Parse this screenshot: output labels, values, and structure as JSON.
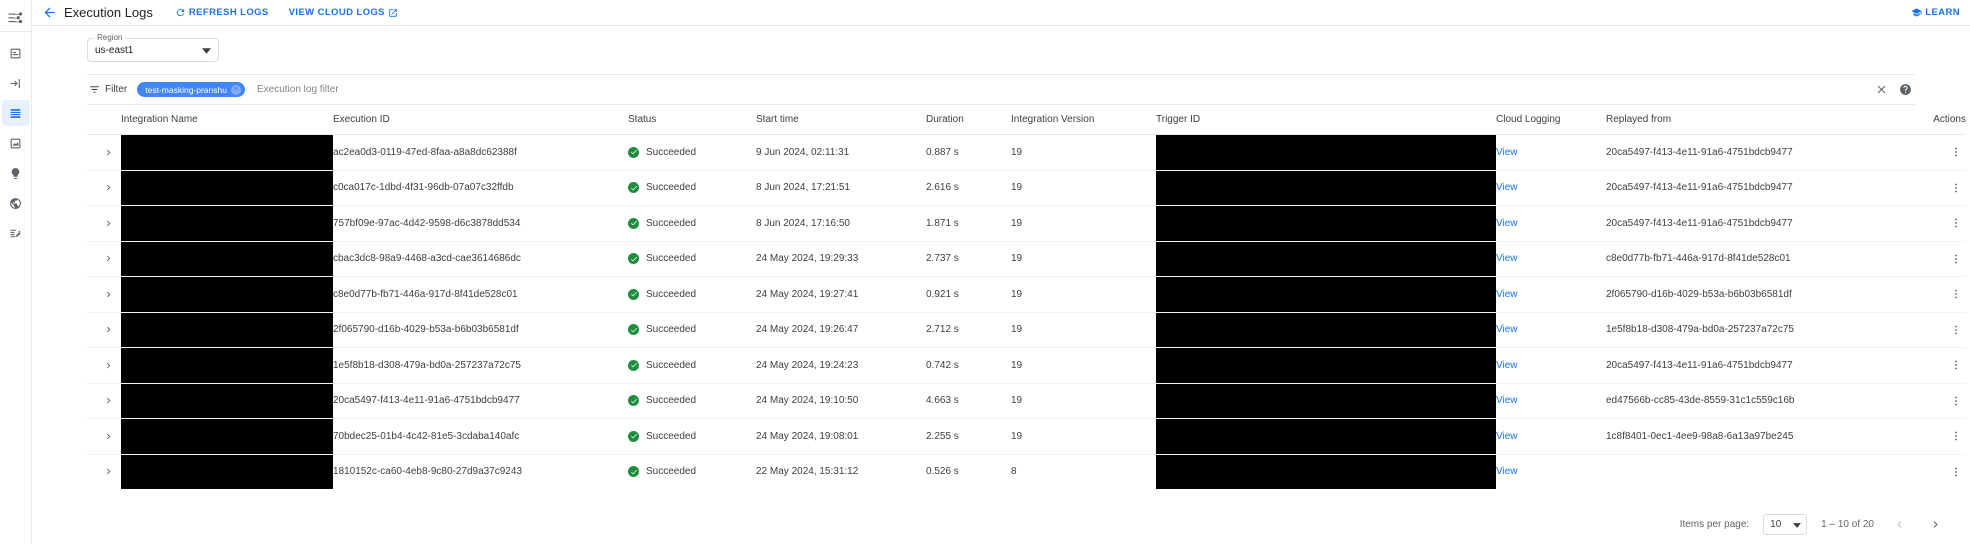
{
  "rail": {
    "logo_icon": "integrations-logo-icon",
    "items": [
      {
        "icon": "overview-icon",
        "active": false
      },
      {
        "icon": "connections-icon",
        "active": false
      },
      {
        "icon": "integrations-list-icon",
        "active": true
      },
      {
        "icon": "analytics-icon",
        "active": false
      },
      {
        "icon": "insights-icon",
        "active": false
      },
      {
        "icon": "globe-icon",
        "active": false
      },
      {
        "icon": "test-cases-icon",
        "active": false
      }
    ]
  },
  "topbar": {
    "back_icon": "back-arrow-icon",
    "title": "Execution Logs",
    "refresh_label": "REFRESH LOGS",
    "refresh_icon": "refresh-icon",
    "cloud_logs_label": "VIEW CLOUD LOGS",
    "cloud_logs_icon": "open-in-new-icon",
    "learn_label": "LEARN",
    "learn_icon": "school-icon"
  },
  "region": {
    "label": "Region",
    "value": "us-east1",
    "caret_icon": "chevron-down-icon"
  },
  "filter": {
    "icon": "filter-icon",
    "label": "Filter",
    "chip_label": "test-masking-pranshu",
    "chip_remove_icon": "chip-close-icon",
    "placeholder": "Execution log filter",
    "input_value": "",
    "clear_icon": "close-icon",
    "help_icon": "help-icon"
  },
  "table": {
    "columns": [
      "",
      "Integration Name",
      "Execution ID",
      "Status",
      "Start time",
      "Duration",
      "Integration Version",
      "Trigger ID",
      "Cloud Logging",
      "Replayed from",
      "Actions"
    ],
    "expand_icon": "chevron-right-icon",
    "status_icon": "check-circle-icon",
    "cloud_link_label": "View",
    "actions_icon": "more-vert-icon",
    "rows": [
      {
        "name_redacted": true,
        "execution_id": "ac2ea0d3-0119-47ed-8faa-a8a8dc62388f",
        "status": "Succeeded",
        "start_time": "9 Jun 2024, 02:11:31",
        "duration": "0.887 s",
        "version": "19",
        "trigger_redacted": true,
        "cloud": "View",
        "replayed_from": "20ca5497-f413-4e11-91a6-4751bdcb9477"
      },
      {
        "name_redacted": true,
        "execution_id": "c0ca017c-1dbd-4f31-96db-07a07c32ffdb",
        "status": "Succeeded",
        "start_time": "8 Jun 2024, 17:21:51",
        "duration": "2.616 s",
        "version": "19",
        "trigger_redacted": true,
        "cloud": "View",
        "replayed_from": "20ca5497-f413-4e11-91a6-4751bdcb9477"
      },
      {
        "name_redacted": true,
        "execution_id": "757bf09e-97ac-4d42-9598-d6c3878dd534",
        "status": "Succeeded",
        "start_time": "8 Jun 2024, 17:16:50",
        "duration": "1.871 s",
        "version": "19",
        "trigger_redacted": true,
        "cloud": "View",
        "replayed_from": "20ca5497-f413-4e11-91a6-4751bdcb9477"
      },
      {
        "name_redacted": true,
        "execution_id": "cbac3dc8-98a9-4468-a3cd-cae3614686dc",
        "status": "Succeeded",
        "start_time": "24 May 2024, 19:29:33",
        "duration": "2.737 s",
        "version": "19",
        "trigger_redacted": true,
        "cloud": "View",
        "replayed_from": "c8e0d77b-fb71-446a-917d-8f41de528c01"
      },
      {
        "name_redacted": true,
        "execution_id": "c8e0d77b-fb71-446a-917d-8f41de528c01",
        "status": "Succeeded",
        "start_time": "24 May 2024, 19:27:41",
        "duration": "0.921 s",
        "version": "19",
        "trigger_redacted": true,
        "cloud": "View",
        "replayed_from": "2f065790-d16b-4029-b53a-b6b03b6581df"
      },
      {
        "name_redacted": true,
        "execution_id": "2f065790-d16b-4029-b53a-b6b03b6581df",
        "status": "Succeeded",
        "start_time": "24 May 2024, 19:26:47",
        "duration": "2.712 s",
        "version": "19",
        "trigger_redacted": true,
        "cloud": "View",
        "replayed_from": "1e5f8b18-d308-479a-bd0a-257237a72c75"
      },
      {
        "name_redacted": true,
        "execution_id": "1e5f8b18-d308-479a-bd0a-257237a72c75",
        "status": "Succeeded",
        "start_time": "24 May 2024, 19:24:23",
        "duration": "0.742 s",
        "version": "19",
        "trigger_redacted": true,
        "cloud": "View",
        "replayed_from": "20ca5497-f413-4e11-91a6-4751bdcb9477"
      },
      {
        "name_redacted": true,
        "execution_id": "20ca5497-f413-4e11-91a6-4751bdcb9477",
        "status": "Succeeded",
        "start_time": "24 May 2024, 19:10:50",
        "duration": "4.663 s",
        "version": "19",
        "trigger_redacted": true,
        "cloud": "View",
        "replayed_from": "ed47566b-cc85-43de-8559-31c1c559c16b"
      },
      {
        "name_redacted": true,
        "execution_id": "70bdec25-01b4-4c42-81e5-3cdaba140afc",
        "status": "Succeeded",
        "start_time": "24 May 2024, 19:08:01",
        "duration": "2.255 s",
        "version": "19",
        "trigger_redacted": true,
        "cloud": "View",
        "replayed_from": "1c8f8401-0ec1-4ee9-98a8-6a13a97be245"
      },
      {
        "name_redacted": true,
        "execution_id": "1810152c-ca60-4eb8-9c80-27d9a37c9243",
        "status": "Succeeded",
        "start_time": "22 May 2024, 15:31:12",
        "duration": "0.526 s",
        "version": "8",
        "trigger_redacted": true,
        "cloud": "View",
        "replayed_from": ""
      }
    ]
  },
  "paginator": {
    "items_per_page_label": "Items per page:",
    "items_per_page_value": "10",
    "range_label": "1 – 10 of 20",
    "prev_icon": "chevron-left-icon",
    "next_icon": "chevron-right-icon"
  },
  "colors": {
    "accent": "#1a73e8",
    "chip": "#4285f4",
    "success": "#1e8e3e"
  }
}
